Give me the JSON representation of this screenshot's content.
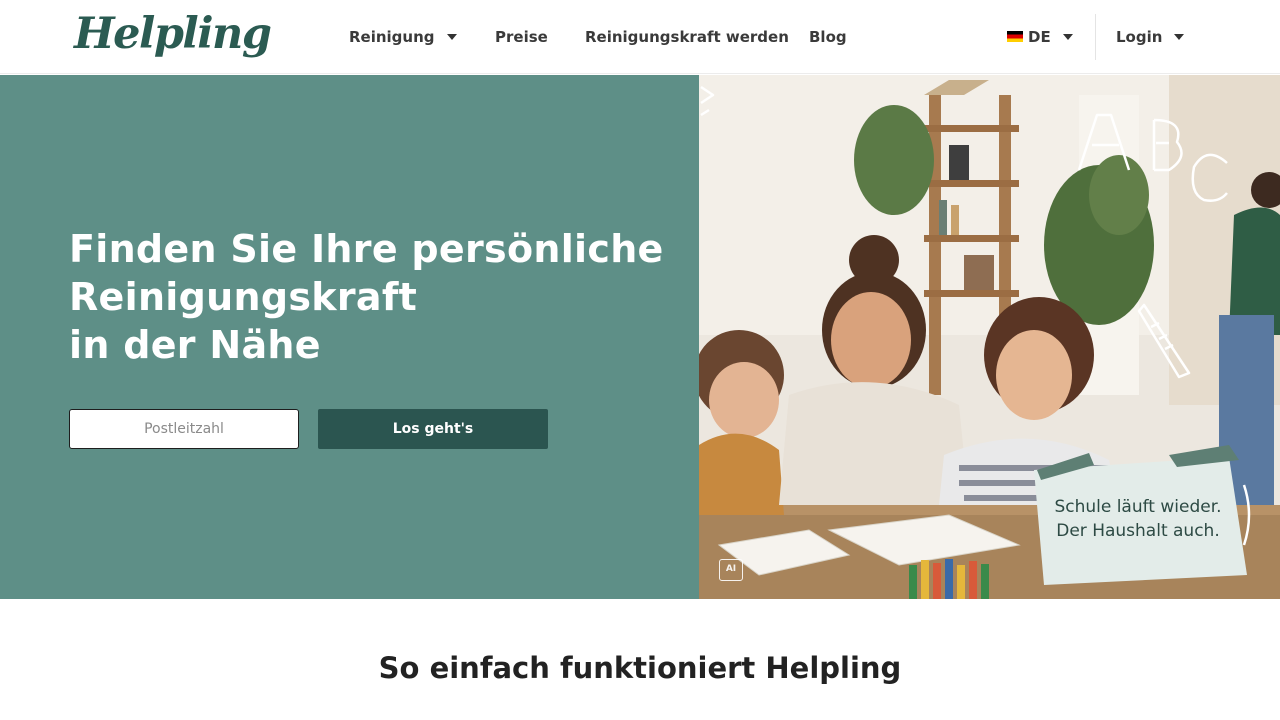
{
  "brand": {
    "logo_text": "Helpling",
    "color": "#2b5b52"
  },
  "nav": {
    "items": [
      {
        "label": "Reinigung",
        "has_dropdown": true
      },
      {
        "label": "Preise",
        "has_dropdown": false
      },
      {
        "label": "Reinigungskraft werden",
        "has_dropdown": false
      },
      {
        "label": "Blog",
        "has_dropdown": false
      }
    ],
    "language": {
      "label": "DE",
      "flag": "germany-flag-icon"
    },
    "login": {
      "label": "Login"
    }
  },
  "hero": {
    "title_lines": [
      "Finden Sie Ihre persönliche",
      "Reinigungskraft",
      "in der Nähe"
    ],
    "postcode_placeholder": "Postleitzahl",
    "button_label": "Los geht's",
    "background": "#5e8f87",
    "button_color": "#2b5550",
    "image": {
      "callout_lines": [
        "Schule läuft wieder.",
        "Der Haushalt auch."
      ],
      "doodle_letters": [
        "A",
        "B",
        "C"
      ],
      "ai_badge": "AI"
    }
  },
  "section": {
    "title": "So einfach funktioniert Helpling"
  }
}
